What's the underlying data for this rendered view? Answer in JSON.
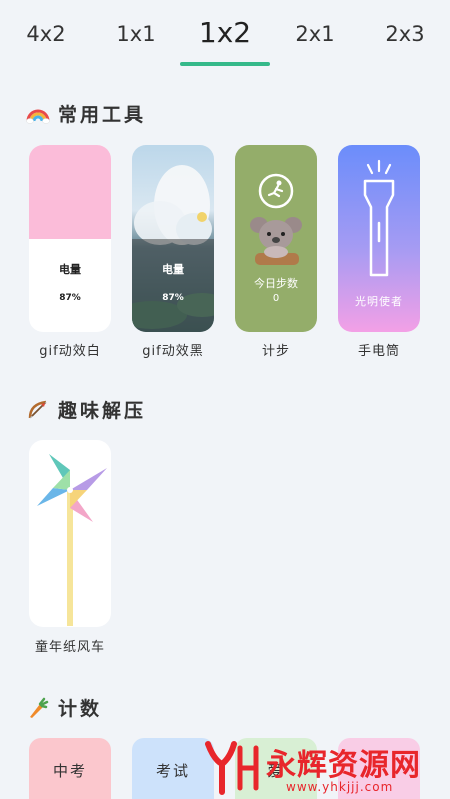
{
  "tabs": [
    "4x2",
    "1x1",
    "1x2",
    "2x1",
    "2x3"
  ],
  "active_tab": "1x2",
  "sections": {
    "tools": {
      "title": "常用工具",
      "cards": [
        {
          "label": "gif动效白",
          "line1": "电量",
          "line2": "87%"
        },
        {
          "label": "gif动效黑",
          "line1": "电量",
          "line2": "87%"
        },
        {
          "label": "计步",
          "line1": "今日步数",
          "line2": "0"
        },
        {
          "label": "手电筒",
          "line1": "光明使者"
        }
      ]
    },
    "fun": {
      "title": "趣味解压",
      "cards": [
        {
          "label": "童年纸风车"
        }
      ]
    },
    "count": {
      "title": "计数",
      "cards": [
        {
          "text": "中考"
        },
        {
          "text": "考试"
        },
        {
          "text": "爱"
        }
      ]
    }
  },
  "watermark": {
    "brand": "永辉资源网",
    "url": "www.yhkjjj.com"
  },
  "colors": {
    "accent": "#35b98a",
    "pink": "#fbbcd9",
    "green": "#94ad6a",
    "flash_gradient_top": "#6b8dfb",
    "flash_gradient_bottom": "#f3a0e6",
    "watermark_red": "#e8262b"
  }
}
